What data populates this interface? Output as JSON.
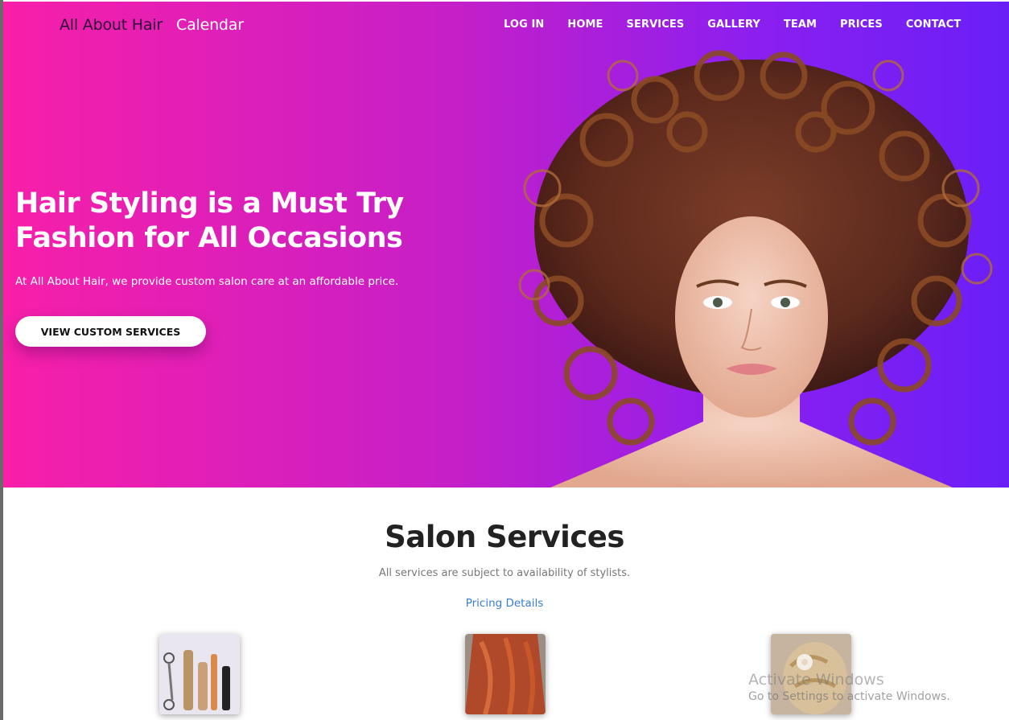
{
  "header": {
    "brand": "All About Hair",
    "calendar": "Calendar",
    "nav": [
      "LOG IN",
      "HOME",
      "SERVICES",
      "GALLERY",
      "TEAM",
      "PRICES",
      "CONTACT"
    ]
  },
  "hero": {
    "title": "Hair Styling is a Must Try Fashion for All Occasions",
    "subtitle": "At All About Hair, we provide custom salon care at an affordable price.",
    "cta": "VIEW CUSTOM SERVICES"
  },
  "services": {
    "title": "Salon Services",
    "subtitle": "All services are subject to availability of stylists.",
    "pricing_link": "Pricing Details",
    "thumbnails": [
      "hair-tools-image",
      "red-hair-image",
      "updo-flower-image"
    ]
  },
  "watermark": {
    "line1": "Activate Windows",
    "line2": "Go to Settings to activate Windows."
  },
  "colors": {
    "gradient_start": "#f81fa9",
    "gradient_end": "#6a1ff7",
    "link": "#3a7bd5"
  }
}
